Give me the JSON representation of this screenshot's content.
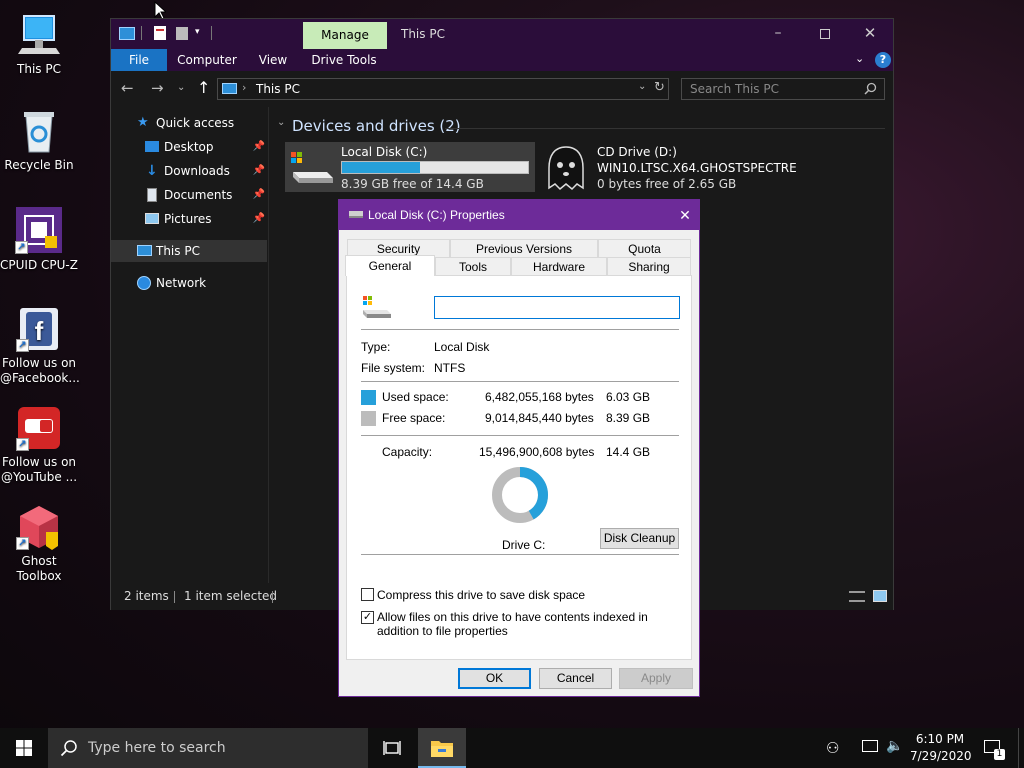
{
  "desktop": {
    "icons": [
      {
        "label": "This PC"
      },
      {
        "label": "Recycle Bin"
      },
      {
        "label": "CPUID CPU-Z"
      },
      {
        "label": "Follow us on @Facebook..."
      },
      {
        "label": "Follow us on @YouTube ..."
      },
      {
        "label": "Ghost Toolbox"
      }
    ]
  },
  "explorer": {
    "title": "This PC",
    "manage_tab": "Manage",
    "ribbon_tabs": [
      "File",
      "Computer",
      "View",
      "Drive Tools"
    ],
    "address": "This PC",
    "search_placeholder": "Search This PC",
    "nav": {
      "quick_access": "Quick access",
      "desktop": "Desktop",
      "downloads": "Downloads",
      "documents": "Documents",
      "pictures": "Pictures",
      "this_pc": "This PC",
      "network": "Network"
    },
    "section_header": "Devices and drives (2)",
    "drives": [
      {
        "name": "Local Disk (C:)",
        "free_text": "8.39 GB free of 14.4 GB",
        "used_fraction": 0.42
      },
      {
        "name": "CD Drive (D:)",
        "label": "WIN10.LTSC.X64.GHOSTSPECTRE",
        "free_text": "0 bytes free of 2.65 GB"
      }
    ],
    "status": {
      "items": "2 items",
      "selected": "1 item selected"
    }
  },
  "dialog": {
    "title": "Local Disk (C:) Properties",
    "tabs_row1": [
      "Security",
      "Previous Versions",
      "Quota"
    ],
    "tabs_row2": [
      "General",
      "Tools",
      "Hardware",
      "Sharing"
    ],
    "name_value": "",
    "type_label": "Type:",
    "type_value": "Local Disk",
    "fs_label": "File system:",
    "fs_value": "NTFS",
    "used_label": "Used space:",
    "used_bytes": "6,482,055,168 bytes",
    "used_gb": "6.03 GB",
    "free_label": "Free space:",
    "free_bytes": "9,014,845,440 bytes",
    "free_gb": "8.39 GB",
    "capacity_label": "Capacity:",
    "capacity_bytes": "15,496,900,608 bytes",
    "capacity_gb": "14.4 GB",
    "drive_label": "Drive C:",
    "used_fraction": 0.418,
    "disk_cleanup": "Disk Cleanup",
    "compress_label": "Compress this drive to save disk space",
    "compress_checked": false,
    "index_label": "Allow files on this drive to have contents indexed in addition to file properties",
    "index_checked": true,
    "ok": "OK",
    "cancel": "Cancel",
    "apply": "Apply",
    "colors": {
      "used": "#26a0da",
      "free": "#bcbcbc",
      "accent": "#6d2b99"
    }
  },
  "taskbar": {
    "search_placeholder": "Type here to search",
    "time": "6:10 PM",
    "date": "7/29/2020"
  }
}
